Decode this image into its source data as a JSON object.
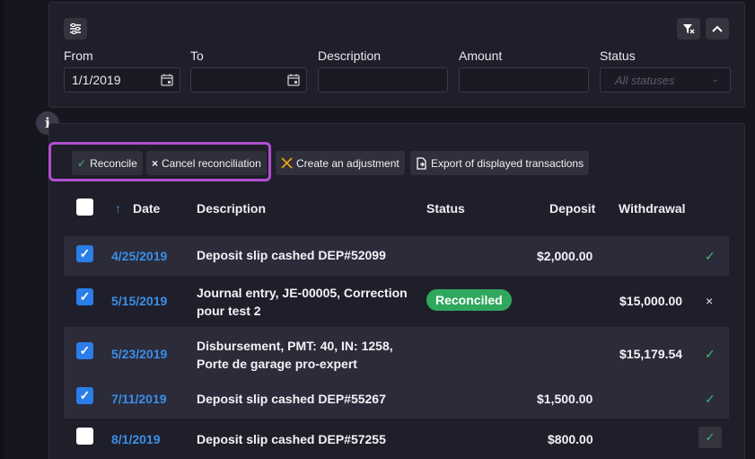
{
  "filters": {
    "from_label": "From",
    "from_value": "1/1/2019",
    "to_label": "To",
    "to_value": "",
    "description_label": "Description",
    "amount_label": "Amount",
    "status_label": "Status",
    "status_placeholder": "All statuses"
  },
  "toolbar": {
    "reconcile_label": "Reconcile",
    "cancel_label": "Cancel reconciliation",
    "adjustment_label": "Create an adjustment",
    "export_label": "Export of displayed transactions"
  },
  "table": {
    "headers": {
      "date": "Date",
      "description": "Description",
      "status": "Status",
      "deposit": "Deposit",
      "withdrawal": "Withdrawal"
    },
    "rows": [
      {
        "date": "4/25/2019",
        "description": "Deposit slip cashed DEP#52099",
        "status": "",
        "deposit": "$2,000.00",
        "withdrawal": "",
        "checked": true
      },
      {
        "date": "5/15/2019",
        "description_line1": "Journal entry, JE-00005, Correction",
        "description_line2": "pour test 2",
        "status": "Reconciled",
        "deposit": "",
        "withdrawal": "$15,000.00",
        "checked": true
      },
      {
        "date": "5/23/2019",
        "description_line1": "Disbursement, PMT: 40, IN: 1258,",
        "description_line2": "Porte de garage pro-expert",
        "status": "",
        "deposit": "",
        "withdrawal": "$15,179.54",
        "checked": true
      },
      {
        "date": "7/11/2019",
        "description": "Deposit slip cashed DEP#55267",
        "status": "",
        "deposit": "$1,500.00",
        "withdrawal": "",
        "checked": true
      },
      {
        "date": "8/1/2019",
        "description": "Deposit slip cashed DEP#57255",
        "status": "",
        "deposit": "$800.00",
        "withdrawal": "",
        "checked": false
      }
    ]
  },
  "icons": {
    "info": "i",
    "sort_asc": "↑",
    "check": "✓",
    "cross": "×"
  },
  "colors": {
    "accent_blue": "#2b7de9",
    "reconciled_green": "#2fa85e",
    "highlight_purple": "#b04fd0",
    "adjustment_orange": "#e3a21a"
  }
}
